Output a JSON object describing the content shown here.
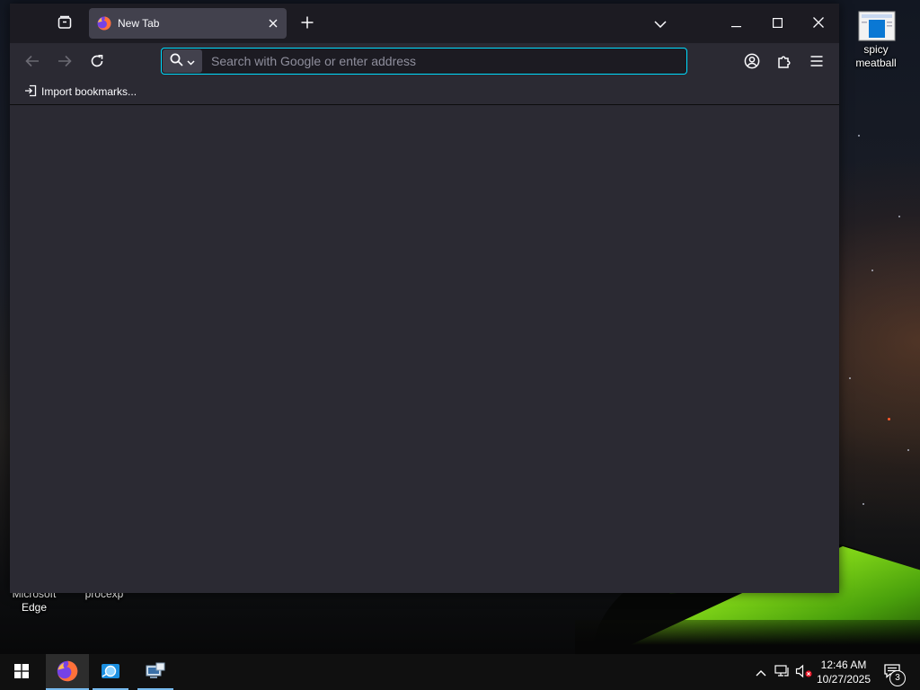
{
  "browser": {
    "tab": {
      "title": "New Tab",
      "favicon": "firefox-icon"
    },
    "urlbar": {
      "placeholder": "Search with Google or enter address",
      "value": ""
    },
    "bookmarks": {
      "import_label": "Import bookmarks..."
    },
    "accent_color": "#00ddff",
    "toolbar_color": "#2b2a33",
    "titlebar_color": "#1c1b22"
  },
  "desktop": {
    "icons": [
      {
        "label": "spicy meatball",
        "icon": "document-icon"
      },
      {
        "label": "Microsoft Edge",
        "icon": "edge-icon"
      },
      {
        "label": "procexp",
        "icon": "procexp-icon"
      }
    ]
  },
  "taskbar": {
    "apps": [
      {
        "name": "Firefox",
        "icon": "firefox-icon",
        "active": true
      },
      {
        "name": "Internet Explorer",
        "icon": "ie-icon",
        "active": false
      },
      {
        "name": "Network Settings",
        "icon": "network-app-icon",
        "active": false
      }
    ],
    "clock": {
      "time": "12:46 AM",
      "date": "10/27/2025"
    },
    "notifications": {
      "count": "3"
    }
  }
}
